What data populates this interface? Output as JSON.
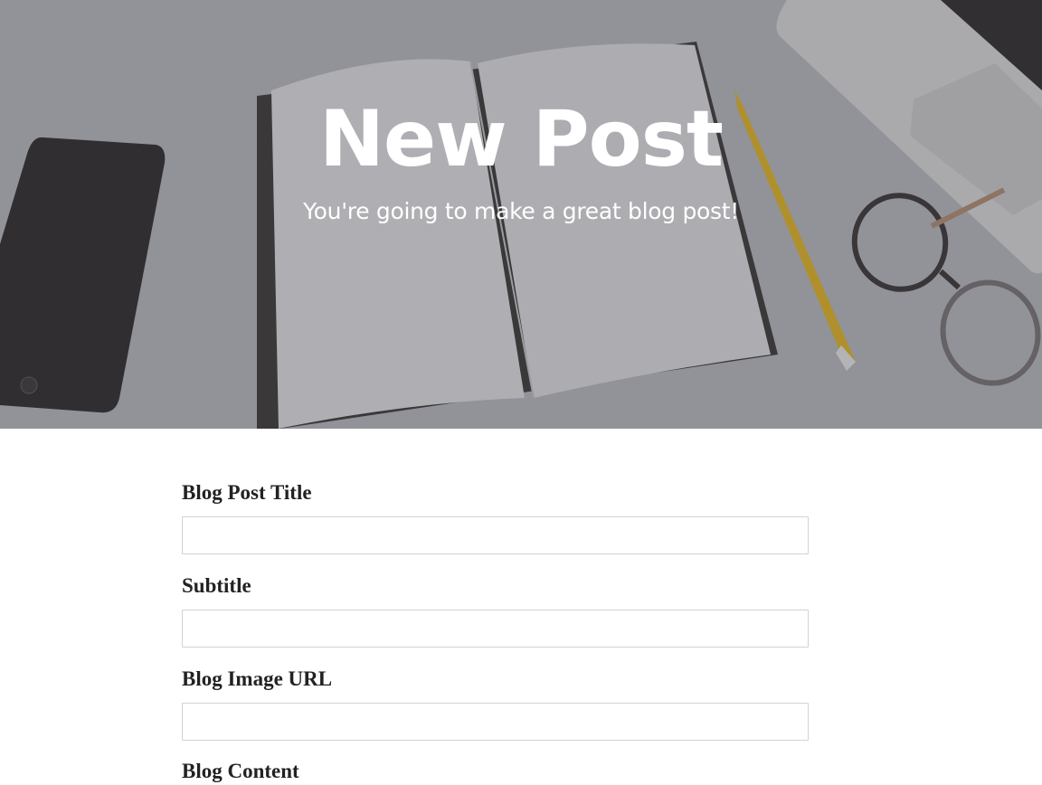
{
  "hero": {
    "title": "New Post",
    "subtitle": "You're going to make a great blog post!"
  },
  "form": {
    "fields": [
      {
        "label": "Blog Post Title",
        "value": "",
        "placeholder": ""
      },
      {
        "label": "Subtitle",
        "value": "",
        "placeholder": ""
      },
      {
        "label": "Blog Image URL",
        "value": "",
        "placeholder": ""
      },
      {
        "label": "Blog Content"
      }
    ]
  },
  "colors": {
    "hero_overlay": "#3c3e48",
    "label_text": "#222222",
    "input_border": "#ced4da"
  }
}
